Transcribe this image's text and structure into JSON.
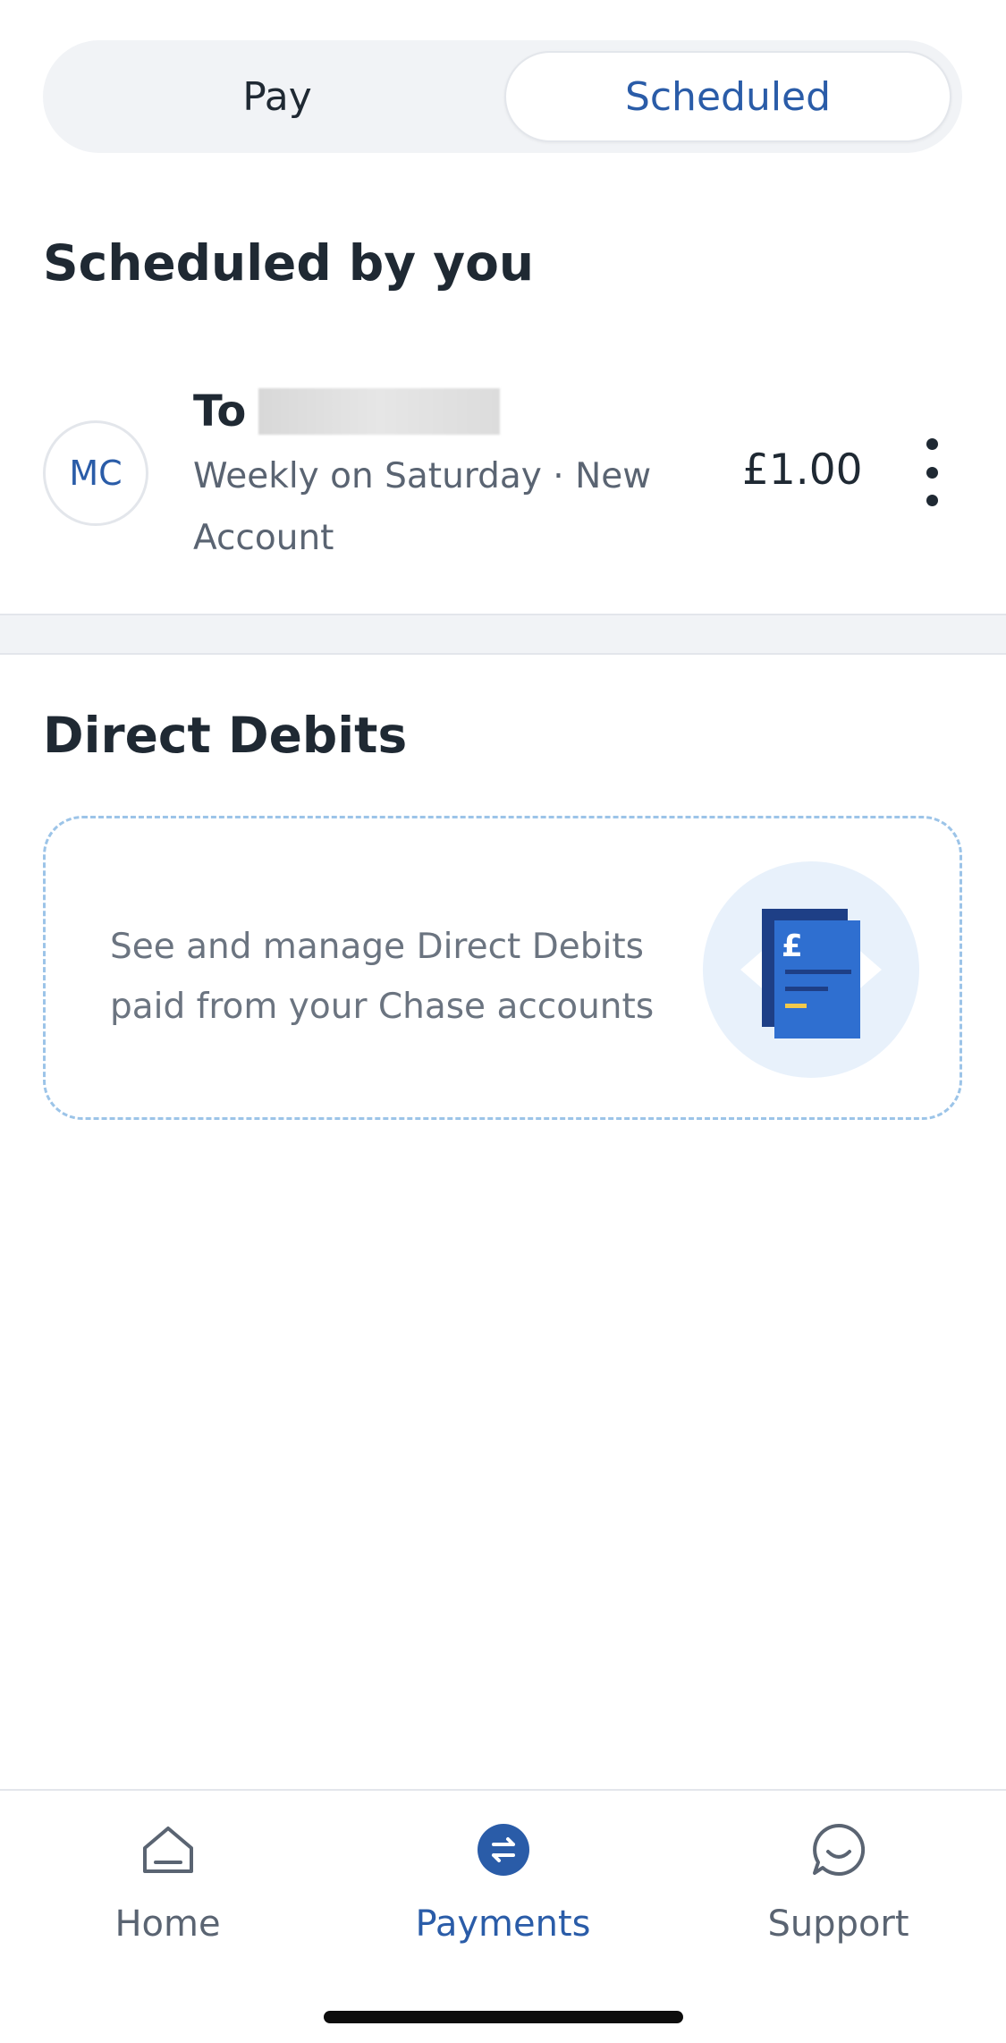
{
  "tabs": {
    "pay_label": "Pay",
    "scheduled_label": "Scheduled",
    "active": "scheduled"
  },
  "scheduled": {
    "title": "Scheduled by you",
    "items": [
      {
        "initials": "MC",
        "to_label": "To",
        "name": "",
        "frequency": "Weekly on Saturday",
        "separator": "·",
        "account": "New Account",
        "amount": "£1.00"
      }
    ]
  },
  "direct_debits": {
    "title": "Direct Debits",
    "description": "See and manage Direct Debits paid from your Chase accounts"
  },
  "nav": {
    "home_label": "Home",
    "payments_label": "Payments",
    "support_label": "Support",
    "active": "payments"
  },
  "colors": {
    "accent": "#2a5ca8",
    "text": "#1f2933",
    "muted": "#5a6472",
    "surface": "#f1f3f6",
    "card_border": "#9cc4e8"
  },
  "icons": {
    "home": "home-icon",
    "payments": "transfer-arrows-icon",
    "support": "chat-bubble-icon",
    "more": "more-vertical-icon",
    "direct_debit": "pound-document-icon"
  }
}
